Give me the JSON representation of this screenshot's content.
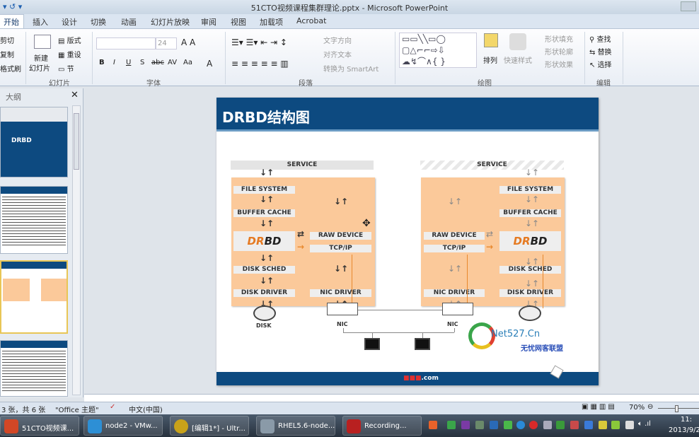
{
  "window": {
    "title": "51CTO视频课程集群理论.pptx - Microsoft PowerPoint"
  },
  "tabs": [
    "开始",
    "插入",
    "设计",
    "切换",
    "动画",
    "幻灯片放映",
    "审阅",
    "视图",
    "加载项",
    "Acrobat"
  ],
  "ribbon": {
    "clipboard": {
      "cut": "剪切",
      "copy": "复制",
      "format_painter": "格式刷"
    },
    "slides": {
      "new_slide_1": "新建",
      "new_slide_2": "幻灯片",
      "layout": "版式",
      "reset": "重设",
      "section": "节",
      "label": "幻灯片"
    },
    "font": {
      "size": "24",
      "bold": "B",
      "italic": "I",
      "underline": "U",
      "shadow": "S",
      "strike": "abc",
      "spacing": "AV",
      "case": "Aa",
      "color": "A",
      "label": "字体"
    },
    "paragraph": {
      "text_direction": "文字方向",
      "align_text": "对齐文本",
      "smartart": "转换为 SmartArt",
      "label": "段落"
    },
    "drawing": {
      "arrange": "排列",
      "quick_styles": "快速样式",
      "shape_fill": "形状填充",
      "shape_outline": "形状轮廓",
      "shape_effects": "形状效果",
      "label": "绘图"
    },
    "editing": {
      "find": "查找",
      "replace": "替换",
      "select": "选择",
      "label": "编辑"
    }
  },
  "left_panel": {
    "tab_outline": "大纲",
    "slide1_title": "DRBD"
  },
  "slide": {
    "title": "DRBD结构图",
    "service": "SERVICE",
    "file_system": "FILE SYSTEM",
    "buffer_cache": "BUFFER CACHE",
    "raw_device": "RAW DEVICE",
    "tcp_ip": "TCP/IP",
    "disk_sched": "DISK SCHED",
    "disk_driver": "DISK DRIVER",
    "nic_driver": "NIC DRIVER",
    "drbd_logo": "DRBD",
    "disk": "DISK",
    "nic": "NIC",
    "watermark": "Net527.Cn",
    "watermark_sub": "无忧网客联盟",
    "footer": ".com"
  },
  "status": {
    "slide_info": "3 张，共 6 张",
    "theme": "\"Office 主题\"",
    "language": "中文(中国)",
    "zoom": "70%"
  },
  "taskbar": {
    "items": [
      "51CTO视频课...",
      "node2 - VMw...",
      "[编辑1*] - Ultr...",
      "RHEL5.6-node...",
      "Recording..."
    ],
    "time": "11:",
    "date": "2013/9/2"
  },
  "colors": {
    "slide_header": "#0d4a80",
    "orange_box": "#fbc99a",
    "drbd_orange": "#e57a22"
  }
}
